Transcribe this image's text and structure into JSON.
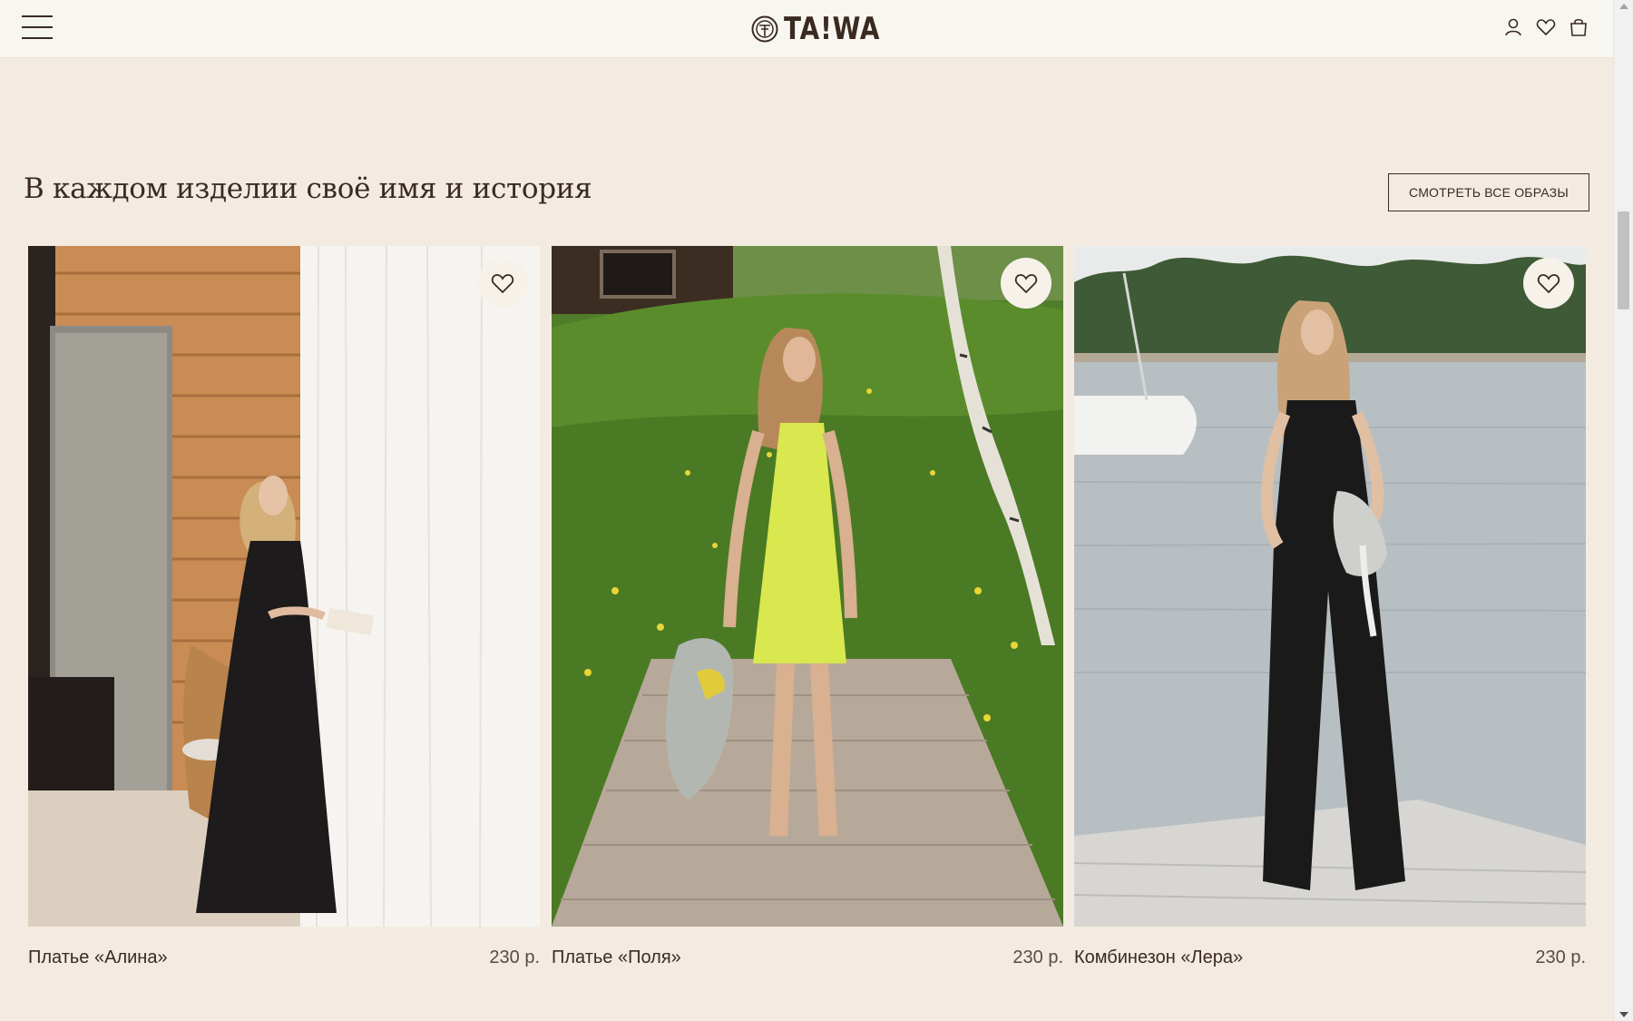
{
  "header": {
    "logo_text": "TA!WA",
    "menu_icon": "hamburger-menu-icon",
    "icons": [
      "account-icon",
      "heart-icon",
      "bag-icon"
    ]
  },
  "section": {
    "title": "В каждом изделии своё имя и история",
    "view_all_label": "СМОТРЕТЬ ВСЕ ОБРАЗЫ"
  },
  "products": [
    {
      "name": "Платье «Алина»",
      "price": "230 р."
    },
    {
      "name": "Платье «Поля»",
      "price": "230 р."
    },
    {
      "name": "Комбинезон «Лера»",
      "price": "230 р."
    }
  ],
  "colors": {
    "page_background": "#f3ebe1",
    "header_background": "#f8f6f0",
    "text": "#3a2a22"
  }
}
